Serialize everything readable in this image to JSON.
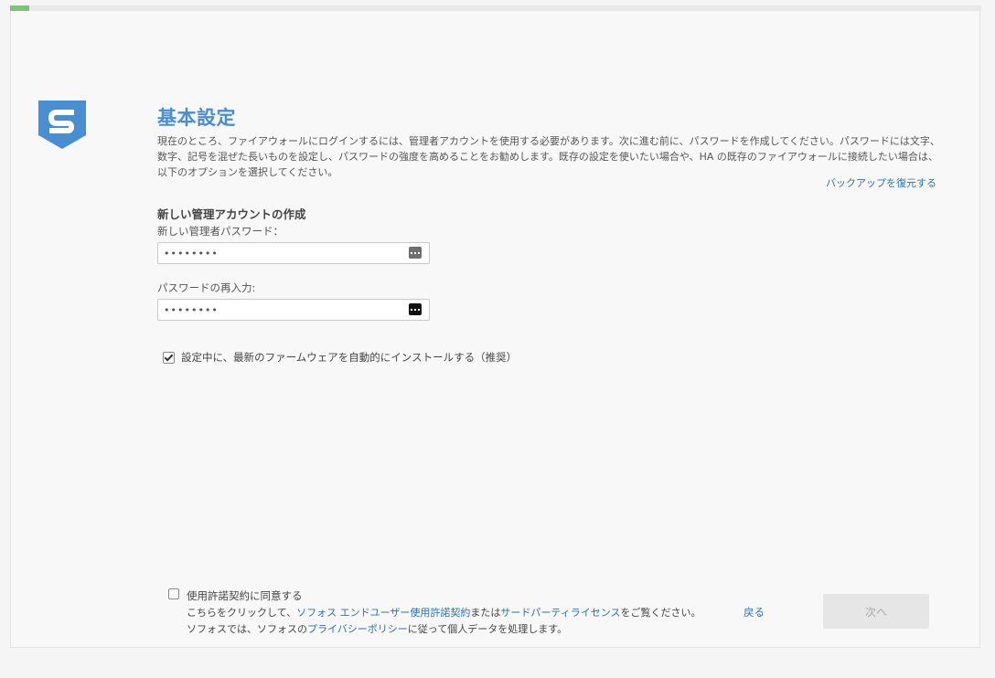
{
  "progress": {
    "fraction": 0.02,
    "color": "#7cc576"
  },
  "logo": {
    "icon": "sophos-shield-icon",
    "color": "#4a8ed2",
    "letter": "S"
  },
  "header": {
    "title": "基本設定",
    "description": "現在のところ、ファイアウォールにログインするには、管理者アカウントを使用する必要があります。次に進む前に、パスワードを作成してください。パスワードには文字、数字、記号を混ぜた長いものを設定し、パスワードの強度を高めることをお勧めします。既存の設定を使いたい場合や、HA の既存のファイアウォールに接続したい場合は、以下のオプションを選択してください。",
    "restore_link": "バックアップを復元する"
  },
  "form": {
    "section_heading": "新しい管理アカウントの作成",
    "password_label": "新しい管理者パスワード：",
    "password_value": "••••••••",
    "confirm_label": "パスワードの再入力:",
    "confirm_value": "••••••••",
    "firmware_checkbox": {
      "label": "設定中に、最新のファームウェアを自動的にインストールする（推奨）",
      "checked": true
    }
  },
  "footer": {
    "license_checkbox_label": "使用許諾契約に同意する",
    "license_checked": false,
    "line1_prefix": "こちらをクリックして、",
    "eula_link": "ソフォス エンドユーザー使用許諾契約",
    "line1_middle": "または",
    "third_party_link": "サードパーティライセンス",
    "line1_suffix": "をご覧ください。",
    "line2_prefix": "ソフォスでは、ソフォスの",
    "privacy_link": "プライバシーポリシー",
    "line2_suffix": "に従って個人データを処理します。",
    "back_label": "戻る",
    "next_label": "次へ"
  },
  "colors": {
    "accent": "#4a8ed2",
    "link": "#2f6fb3",
    "disabled_button": "#e6e6e6"
  }
}
